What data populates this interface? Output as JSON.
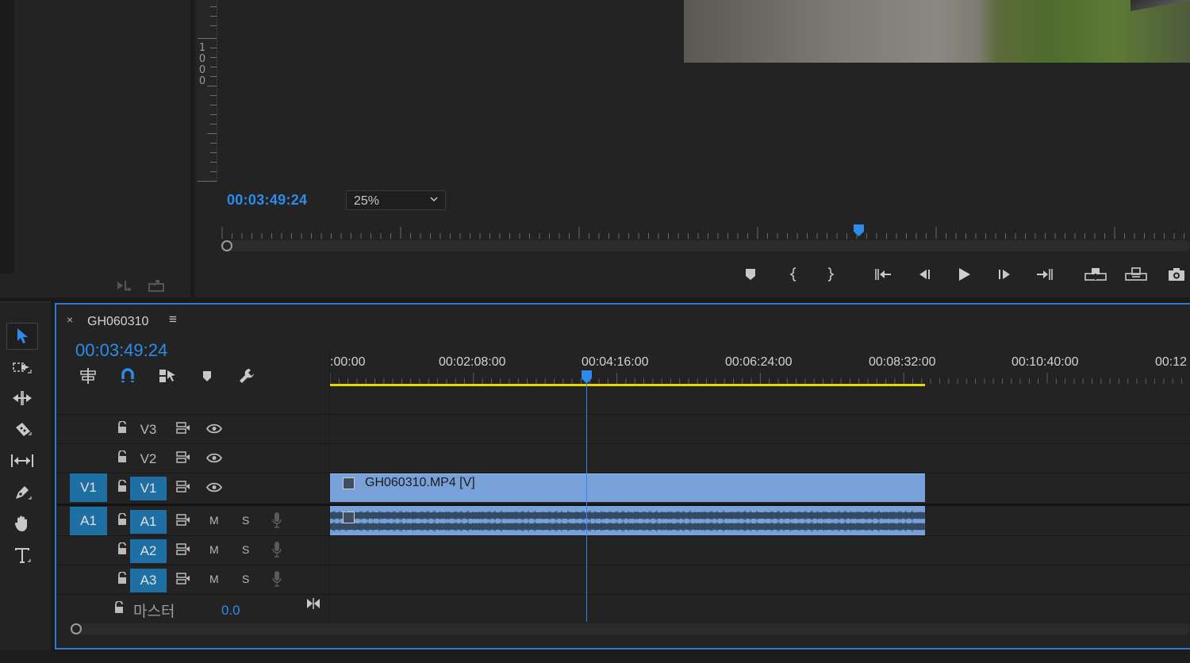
{
  "program_monitor": {
    "ruler_vertical_label": "1000",
    "timecode": "00:03:49:24",
    "zoom": {
      "selected": "25%"
    },
    "transport_icons": [
      "marker-icon",
      "mark-in-icon",
      "mark-out-icon",
      "go-to-in-icon",
      "step-back-icon",
      "play-icon",
      "step-forward-icon",
      "go-to-out-icon",
      "lift-icon",
      "extract-icon",
      "export-frame-icon"
    ]
  },
  "left_panel": {
    "icons": [
      "insert-icon",
      "overwrite-icon"
    ]
  },
  "tools": [
    "selection-tool-icon",
    "track-select-forward-icon",
    "ripple-edit-icon",
    "razor-icon",
    "slip-icon",
    "pen-icon",
    "hand-icon",
    "type-icon"
  ],
  "timeline": {
    "close_glyph": "×",
    "sequence_name": "GH060310",
    "menu_glyph": "≡",
    "timecode": "00:03:49:24",
    "controls": [
      "nest-icon",
      "snap-icon",
      "linked-selection-icon",
      "add-marker-icon",
      "settings-wrench-icon"
    ],
    "ruler_times": [
      ":00:00",
      "00:02:08:00",
      "00:04:16:00",
      "00:06:24:00",
      "00:08:32:00",
      "00:10:40:00",
      "00:12"
    ],
    "video_tracks": [
      {
        "name": "V3",
        "targeted": false,
        "source": ""
      },
      {
        "name": "V2",
        "targeted": false,
        "source": ""
      },
      {
        "name": "V1",
        "targeted": true,
        "source": "V1"
      }
    ],
    "audio_tracks": [
      {
        "name": "A1",
        "targeted": true,
        "source": "A1",
        "mute": "M",
        "solo": "S"
      },
      {
        "name": "A2",
        "targeted": true,
        "source": "",
        "mute": "M",
        "solo": "S"
      },
      {
        "name": "A3",
        "targeted": true,
        "source": "",
        "mute": "M",
        "solo": "S"
      }
    ],
    "master": {
      "label": "마스터",
      "value": "0.0"
    },
    "clips": {
      "video": "GH060310.MP4 [V]"
    }
  },
  "colors": {
    "accent_blue": "#2d8ceb",
    "clip_blue": "#77a1d8",
    "work_area_yellow": "#e6d800",
    "panel_bg": "#232323",
    "track_target": "#1e6fa3"
  }
}
